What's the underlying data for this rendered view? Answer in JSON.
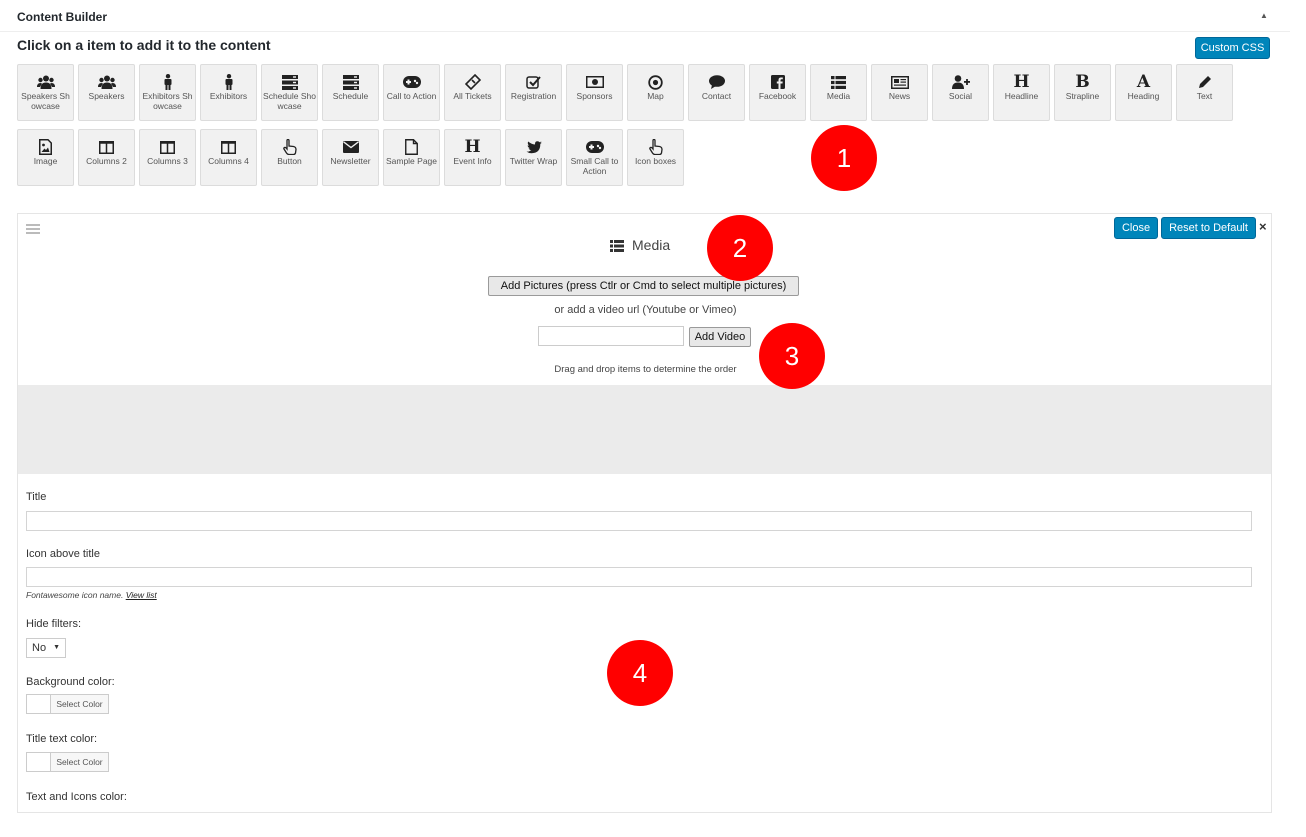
{
  "header": {
    "title": "Content Builder"
  },
  "instruction": "Click on a item to add it to the content",
  "custom_css_label": "Custom CSS",
  "palette": [
    {
      "label": "Speakers Showcase",
      "icon": "users-icon"
    },
    {
      "label": "Speakers",
      "icon": "users-icon"
    },
    {
      "label": "Exhibitors Showcase",
      "icon": "male-icon"
    },
    {
      "label": "Exhibitors",
      "icon": "male-icon"
    },
    {
      "label": "Schedule Showcase",
      "icon": "server-icon"
    },
    {
      "label": "Schedule",
      "icon": "server-icon"
    },
    {
      "label": "Call to Action",
      "icon": "gamepad-icon"
    },
    {
      "label": "All Tickets",
      "icon": "ticket-icon"
    },
    {
      "label": "Registration",
      "icon": "check-square-icon"
    },
    {
      "label": "Sponsors",
      "icon": "money-icon"
    },
    {
      "label": "Map",
      "icon": "dot-circle-icon"
    },
    {
      "label": "Contact",
      "icon": "comment-icon"
    },
    {
      "label": "Facebook",
      "icon": "facebook-icon"
    },
    {
      "label": "Media",
      "icon": "list-icon"
    },
    {
      "label": "News",
      "icon": "newspaper-icon"
    },
    {
      "label": "Social",
      "icon": "user-plus-icon"
    },
    {
      "label": "Headline",
      "icon": "header-icon"
    },
    {
      "label": "Strapline",
      "icon": "bold-icon"
    },
    {
      "label": "Heading",
      "icon": "font-icon"
    },
    {
      "label": "Text",
      "icon": "pencil-icon"
    },
    {
      "label": "Image",
      "icon": "image-file-icon"
    },
    {
      "label": "Columns 2",
      "icon": "columns-icon"
    },
    {
      "label": "Columns 3",
      "icon": "columns-icon"
    },
    {
      "label": "Columns 4",
      "icon": "columns-icon"
    },
    {
      "label": "Button",
      "icon": "hand-pointer-icon"
    },
    {
      "label": "Newsletter",
      "icon": "envelope-icon"
    },
    {
      "label": "Sample Page",
      "icon": "file-icon"
    },
    {
      "label": "Event Info",
      "icon": "header-icon"
    },
    {
      "label": "Twitter Wrap",
      "icon": "twitter-icon"
    },
    {
      "label": "Small Call to Action",
      "icon": "gamepad-icon"
    },
    {
      "label": "Icon boxes",
      "icon": "hand-pointer-icon"
    }
  ],
  "markers": [
    "1",
    "2",
    "3",
    "4"
  ],
  "panel": {
    "title": "Media",
    "close_label": "Close",
    "reset_label": "Reset to Default",
    "close_x": "×",
    "add_pictures_label": "Add Pictures (press Ctlr or Cmd to select multiple pictures)",
    "video_hint": "or add a video url (Youtube or Vimeo)",
    "video_url_value": "",
    "add_video_label": "Add Video",
    "drag_hint": "Drag and drop items to determine the order"
  },
  "form": {
    "title_label": "Title",
    "title_value": "",
    "icon_label": "Icon above title",
    "icon_value": "",
    "icon_note": "Fontawesome icon name.",
    "icon_note_link": "View list",
    "hide_filters_label": "Hide filters:",
    "hide_filters_value": "No",
    "bg_color_label": "Background color:",
    "select_color_label": "Select Color",
    "title_color_label": "Title text color:",
    "text_icons_color_label": "Text and Icons color:"
  },
  "colors": {
    "accent": "#0085ba",
    "marker": "#ff0000",
    "tile_bg": "#f1f1f1"
  }
}
